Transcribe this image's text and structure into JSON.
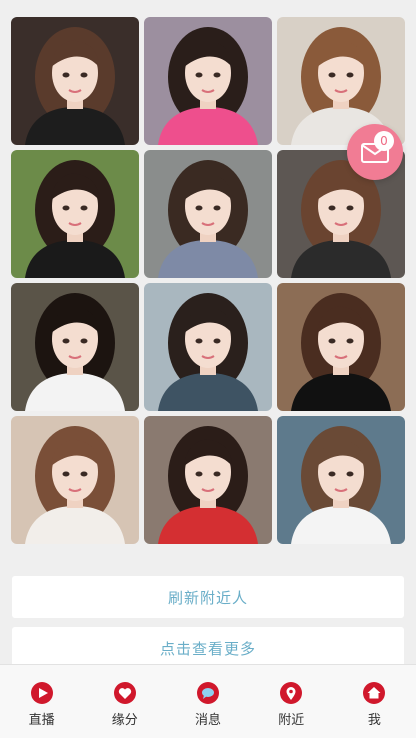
{
  "photos": [
    {
      "name": "photo-1",
      "bg": "#3a2e2a",
      "hair": "#5a3b2c",
      "cloth": "#1d1d1d"
    },
    {
      "name": "photo-2",
      "bg": "#9c8f9f",
      "hair": "#2a1e1a",
      "cloth": "#ee4f8d"
    },
    {
      "name": "photo-3",
      "bg": "#d8d0c6",
      "hair": "#8a5a3a",
      "cloth": "#e9e6e2"
    },
    {
      "name": "photo-4",
      "bg": "#6c8b49",
      "hair": "#2b1d18",
      "cloth": "#1a1a1a"
    },
    {
      "name": "photo-5",
      "bg": "#8a8d8c",
      "hair": "#3a2a22",
      "cloth": "#7e8aa6"
    },
    {
      "name": "photo-6",
      "bg": "#5d5753",
      "hair": "#6a4430",
      "cloth": "#2b2b2b"
    },
    {
      "name": "photo-7",
      "bg": "#5a5448",
      "hair": "#1c1410",
      "cloth": "#f3f3f3"
    },
    {
      "name": "photo-8",
      "bg": "#a9b7bf",
      "hair": "#2a201c",
      "cloth": "#3e5363"
    },
    {
      "name": "photo-9",
      "bg": "#8c6d55",
      "hair": "#4a2d20",
      "cloth": "#111111"
    },
    {
      "name": "photo-10",
      "bg": "#d6c4b4",
      "hair": "#7a4f38",
      "cloth": "#f2eeea"
    },
    {
      "name": "photo-11",
      "bg": "#8a7a70",
      "hair": "#2b1d18",
      "cloth": "#d42f32"
    },
    {
      "name": "photo-12",
      "bg": "#5e7a8c",
      "hair": "#6a4a36",
      "cloth": "#f4f4f4"
    }
  ],
  "mail": {
    "count": "0"
  },
  "buttons": {
    "refresh": "刷新附近人",
    "more": "点击查看更多"
  },
  "tabs": [
    {
      "label": "直播",
      "icon": "live-icon"
    },
    {
      "label": "缘分",
      "icon": "heart-icon"
    },
    {
      "label": "消息",
      "icon": "message-icon"
    },
    {
      "label": "附近",
      "icon": "location-icon"
    },
    {
      "label": "我",
      "icon": "home-icon"
    }
  ],
  "colors": {
    "accent": "#6aaec8",
    "tabIcon": "#d0182c",
    "mail": "#f17c94"
  }
}
